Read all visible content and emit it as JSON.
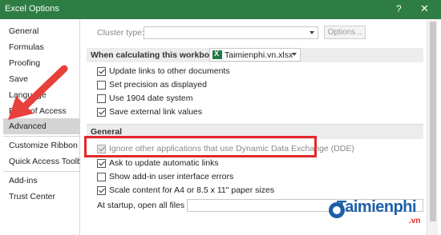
{
  "window": {
    "title": "Excel Options",
    "help_glyph": "?",
    "close_glyph": "✕"
  },
  "sidebar": {
    "items": [
      {
        "label": "General"
      },
      {
        "label": "Formulas"
      },
      {
        "label": "Proofing"
      },
      {
        "label": "Save"
      },
      {
        "label": "Language"
      },
      {
        "label": "Ease of Access"
      },
      {
        "label": "Advanced",
        "selected": true
      },
      {
        "label": "Customize Ribbon"
      },
      {
        "label": "Quick Access Toolbar"
      },
      {
        "label": "Add-ins"
      },
      {
        "label": "Trust Center"
      }
    ]
  },
  "cluster": {
    "label": "Cluster type:",
    "options_button": "Options..."
  },
  "calc_section": {
    "heading": "When calculating this workbook:",
    "workbook": "Taimienphi.vn.xlsx",
    "options": [
      {
        "label": "Update links to other documents",
        "checked": true
      },
      {
        "label": "Set precision as displayed",
        "checked": false
      },
      {
        "label": "Use 1904 date system",
        "checked": false
      },
      {
        "label": "Save external link values",
        "checked": true
      }
    ]
  },
  "general_section": {
    "heading": "General",
    "options": [
      {
        "label": "Ignore other applications that use Dynamic Data Exchange (DDE)",
        "checked": true,
        "disabled": true
      },
      {
        "label": "Ask to update automatic links",
        "checked": true
      },
      {
        "label": "Show add-in user interface errors",
        "checked": false
      },
      {
        "label": "Scale content for A4 or 8.5 x 11\" paper sizes",
        "checked": true
      }
    ],
    "startup_label": "At startup, open all files in:"
  },
  "watermark": {
    "brand": "Taimienphi",
    "suffix": ".vn"
  },
  "colors": {
    "titlebar": "#2e7d44",
    "highlight": "#e3262a",
    "arrow": "#e8403a",
    "brand": "#1d5fa8"
  }
}
